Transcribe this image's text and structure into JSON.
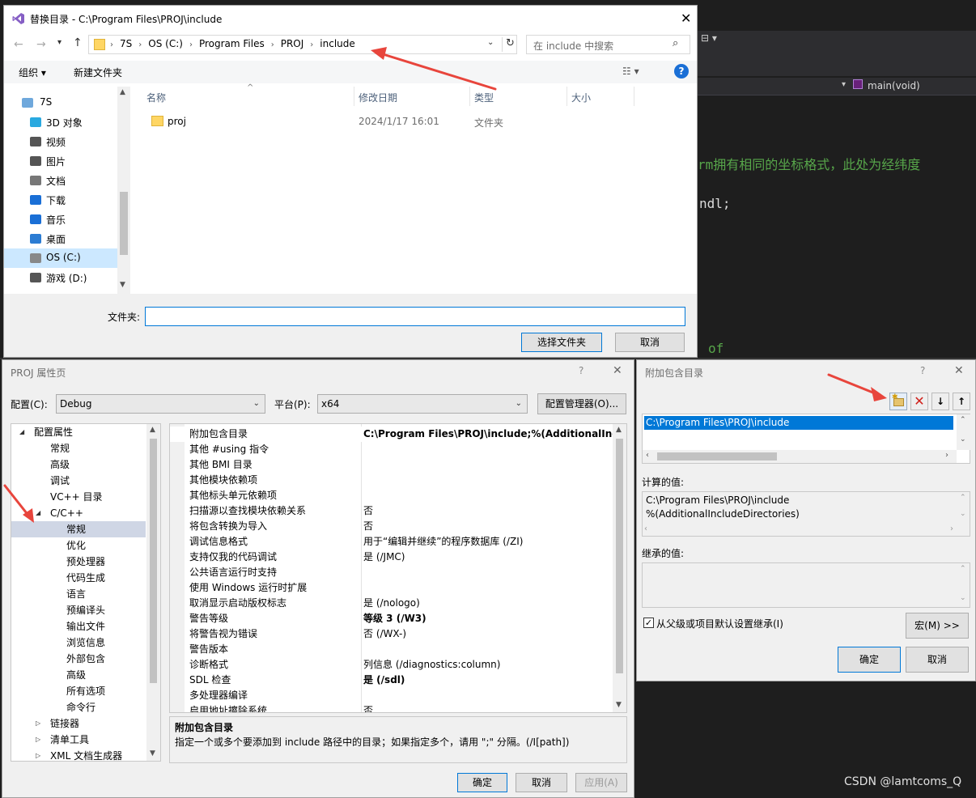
{
  "editor": {
    "func_label": "main(void)",
    "code_comment": "rm拥有相同的坐标格式，此处为经纬度",
    "code_endl": "ndl;",
    "code_of": "of"
  },
  "file_dialog": {
    "title": "替换目录 - C:\\Program Files\\PROJ\\include",
    "breadcrumb": [
      "7S",
      "OS (C:)",
      "Program Files",
      "PROJ",
      "include"
    ],
    "search_placeholder": "在 include 中搜索",
    "toolbar": {
      "organize": "组织",
      "new_folder": "新建文件夹"
    },
    "columns": [
      "名称",
      "修改日期",
      "类型",
      "大小"
    ],
    "files": [
      {
        "name": "proj",
        "date": "2024/1/17 16:01",
        "type": "文件夹",
        "size": ""
      }
    ],
    "nav": [
      "7S",
      "3D 对象",
      "视频",
      "图片",
      "文档",
      "下载",
      "音乐",
      "桌面",
      "OS (C:)",
      "游戏 (D:)"
    ],
    "folder_label": "文件夹:",
    "folder_value": "",
    "select_button": "选择文件夹",
    "cancel_button": "取消"
  },
  "props_dialog": {
    "title": "PROJ 属性页",
    "help": "?",
    "config_label": "配置(C):",
    "config_value": "Debug",
    "platform_label": "平台(P):",
    "platform_value": "x64",
    "config_manager": "配置管理器(O)...",
    "tree": [
      {
        "label": "配置属性",
        "indent": 0,
        "exp": "◢"
      },
      {
        "label": "常规",
        "indent": 1,
        "exp": ""
      },
      {
        "label": "高级",
        "indent": 1,
        "exp": ""
      },
      {
        "label": "调试",
        "indent": 1,
        "exp": ""
      },
      {
        "label": "VC++ 目录",
        "indent": 1,
        "exp": ""
      },
      {
        "label": "C/C++",
        "indent": 1,
        "exp": "◢"
      },
      {
        "label": "常规",
        "indent": 2,
        "exp": "",
        "selected": true
      },
      {
        "label": "优化",
        "indent": 2,
        "exp": ""
      },
      {
        "label": "预处理器",
        "indent": 2,
        "exp": ""
      },
      {
        "label": "代码生成",
        "indent": 2,
        "exp": ""
      },
      {
        "label": "语言",
        "indent": 2,
        "exp": ""
      },
      {
        "label": "预编译头",
        "indent": 2,
        "exp": ""
      },
      {
        "label": "输出文件",
        "indent": 2,
        "exp": ""
      },
      {
        "label": "浏览信息",
        "indent": 2,
        "exp": ""
      },
      {
        "label": "外部包含",
        "indent": 2,
        "exp": ""
      },
      {
        "label": "高级",
        "indent": 2,
        "exp": ""
      },
      {
        "label": "所有选项",
        "indent": 2,
        "exp": ""
      },
      {
        "label": "命令行",
        "indent": 2,
        "exp": ""
      },
      {
        "label": "链接器",
        "indent": 1,
        "exp": "▷"
      },
      {
        "label": "清单工具",
        "indent": 1,
        "exp": "▷"
      },
      {
        "label": "XML 文档生成器",
        "indent": 1,
        "exp": "▷"
      }
    ],
    "grid": [
      {
        "key": "附加包含目录",
        "value": "C:\\Program Files\\PROJ\\include;%(AdditionalIncludeDirectories)",
        "bold": true
      },
      {
        "key": "其他 #using 指令",
        "value": ""
      },
      {
        "key": "其他 BMI 目录",
        "value": ""
      },
      {
        "key": "其他模块依赖项",
        "value": ""
      },
      {
        "key": "其他标头单元依赖项",
        "value": ""
      },
      {
        "key": "扫描源以查找模块依赖关系",
        "value": "否"
      },
      {
        "key": "将包含转换为导入",
        "value": "否"
      },
      {
        "key": "调试信息格式",
        "value": "用于“编辑并继续”的程序数据库 (/ZI)"
      },
      {
        "key": "支持仅我的代码调试",
        "value": "是 (/JMC)"
      },
      {
        "key": "公共语言运行时支持",
        "value": ""
      },
      {
        "key": "使用 Windows 运行时扩展",
        "value": ""
      },
      {
        "key": "取消显示启动版权标志",
        "value": "是 (/nologo)"
      },
      {
        "key": "警告等级",
        "value": "等级 3 (/W3)",
        "bold": true
      },
      {
        "key": "将警告视为错误",
        "value": "否 (/WX-)"
      },
      {
        "key": "警告版本",
        "value": ""
      },
      {
        "key": "诊断格式",
        "value": "列信息 (/diagnostics:column)"
      },
      {
        "key": "SDL 检查",
        "value": "是 (/sdl)",
        "bold": true
      },
      {
        "key": "多处理器编译",
        "value": ""
      },
      {
        "key": "启用地址擦除系统",
        "value": "否"
      }
    ],
    "desc_title": "附加包含目录",
    "desc_text": "指定一个或多个要添加到 include 路径中的目录；如果指定多个，请用 \";\" 分隔。(/I[path])",
    "ok": "确定",
    "cancel": "取消",
    "apply": "应用(A)"
  },
  "include_dialog": {
    "title": "附加包含目录",
    "help": "?",
    "entry": "C:\\Program Files\\PROJ\\include",
    "computed_label": "计算的值:",
    "computed_lines": [
      "C:\\Program Files\\PROJ\\include",
      "%(AdditionalIncludeDirectories)"
    ],
    "inherited_label": "继承的值:",
    "inherit_checkbox": "从父级或项目默认设置继承(I)",
    "inherit_checked": true,
    "macro_button": "宏(M) >>",
    "ok": "确定",
    "cancel": "取消"
  },
  "watermark": "CSDN @lamtcoms_Q",
  "colors": {
    "accent": "#0078d7",
    "arrow": "#e8453c",
    "code_green": "#57a64a"
  }
}
